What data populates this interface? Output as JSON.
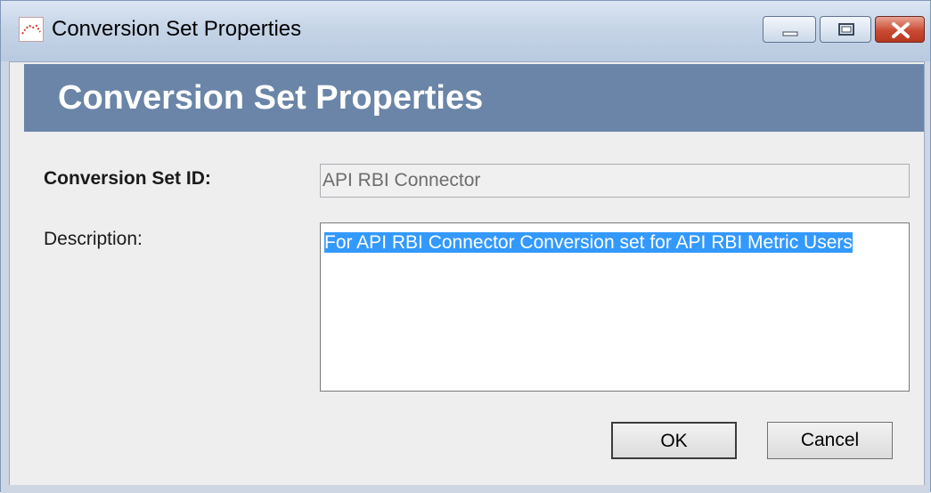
{
  "window": {
    "title": "Conversion Set Properties",
    "controls": {
      "minimize": "minimize",
      "maximize": "maximize",
      "close": "close"
    }
  },
  "banner": {
    "title": "Conversion Set Properties"
  },
  "form": {
    "id_label": "Conversion Set ID:",
    "id_value": "API RBI Connector",
    "description_label": "Description:",
    "description_value": "For API RBI Connector Conversion set for API RBI Metric Users"
  },
  "buttons": {
    "ok": "OK",
    "cancel": "Cancel"
  },
  "colors": {
    "banner": "#6a85a7",
    "selection": "#3399ff",
    "close_button": "#c94b33"
  }
}
